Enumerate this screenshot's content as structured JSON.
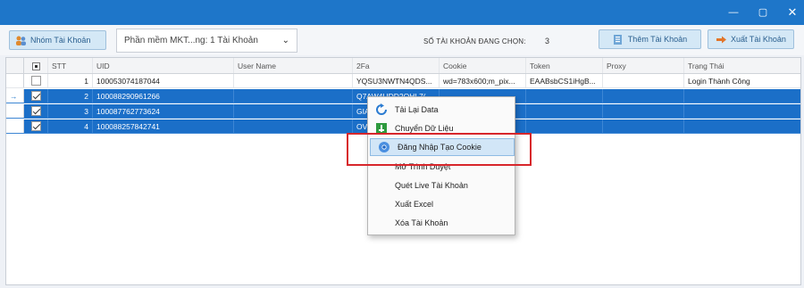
{
  "window": {
    "controls": {
      "minimize": "—",
      "maximize": "▢",
      "close": "✕"
    }
  },
  "toolbar": {
    "group_button_label": "Nhóm Tài Khoản",
    "software_select_value": "Phần mềm  MKT...ng: 1 Tài Khoản",
    "selected_count_label": "SỐ TÀI KHOẢN ĐANG CHỌN:",
    "selected_count_value": "3",
    "add_account_label": "Thêm Tài Khoản",
    "export_account_label": "Xuất Tài Khoản"
  },
  "grid": {
    "columns": {
      "stt": "STT",
      "uid": "UID",
      "username": "User Name",
      "twofa": "2Fa",
      "cookie": "Cookie",
      "token": "Token",
      "proxy": "Proxy",
      "state": "Trạng Thái"
    },
    "rows": [
      {
        "stt": "1",
        "uid": "100053074187044",
        "username": "",
        "twofa": "YQSU3NWTN4QDS...",
        "cookie": "wd=783x600;m_pix...",
        "token": "EAABsbCS1iHgB...",
        "proxy": "",
        "state": "Login Thành Công",
        "checked": false,
        "selected": false,
        "indicator": ""
      },
      {
        "stt": "2",
        "uid": "100088290961266",
        "username": "",
        "twofa": "Q7AW4UDD2QHL7(",
        "cookie": "",
        "token": "",
        "proxy": "",
        "state": "",
        "checked": true,
        "selected": true,
        "indicator": "→"
      },
      {
        "stt": "3",
        "uid": "100087762773624",
        "username": "",
        "twofa": "GIA",
        "cookie": "",
        "token": "",
        "proxy": "",
        "state": "",
        "checked": true,
        "selected": true,
        "indicator": ""
      },
      {
        "stt": "4",
        "uid": "100088257842741",
        "username": "",
        "twofa": "OVL",
        "cookie": "",
        "token": "",
        "proxy": "",
        "state": "",
        "checked": true,
        "selected": true,
        "indicator": ""
      }
    ]
  },
  "context_menu": {
    "items": [
      {
        "label": "Tải Lại Data",
        "icon": "refresh-icon"
      },
      {
        "label": "Chuyển Dữ Liệu",
        "icon": "transfer-icon"
      },
      {
        "label": "Đăng Nhập Tạo Cookie",
        "icon": "chrome-icon",
        "highlighted": true
      },
      {
        "label": "Mở Trình Duyệt",
        "icon": ""
      },
      {
        "label": "Quét Live Tài Khoản",
        "icon": ""
      },
      {
        "label": "Xuất Excel",
        "icon": ""
      },
      {
        "label": "Xóa Tài Khoản",
        "icon": ""
      }
    ]
  },
  "colors": {
    "titlebar": "#1e76c9",
    "selected_row": "#1b6fc8",
    "button_bg": "#d4e8f6",
    "annotation_box": "#d7262b"
  }
}
